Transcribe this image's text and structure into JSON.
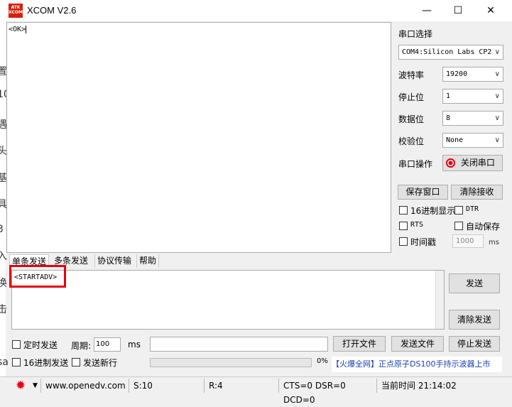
{
  "window": {
    "title": "XCOM V2.6",
    "logo_text": "ATK XCOM",
    "minimize": "—",
    "maximize": "☐",
    "close": "✕"
  },
  "left_strip_chars": [
    "置",
    "10",
    "遇",
    "头",
    "基",
    "具",
    "3",
    "入",
    "换",
    "击",
    "sa"
  ],
  "receive": {
    "text": "<OK>"
  },
  "settings": {
    "port_select_label": "串口选择",
    "port_value": "COM4:Silicon Labs CP2",
    "baud_label": "波特率",
    "baud_value": "19200",
    "stop_label": "停止位",
    "stop_value": "1",
    "data_label": "数据位",
    "data_value": "8",
    "parity_label": "校验位",
    "parity_value": "None",
    "op_label": "串口操作",
    "close_port_label": "关闭串口",
    "save_window_label": "保存窗口",
    "clear_recv_label": "清除接收",
    "hex_display_label": "16进制显示",
    "dtr_label": "DTR",
    "rts_label": "RTS",
    "auto_save_label": "自动保存",
    "timestamp_label": "时间戳",
    "timestamp_ms_value": "1000",
    "ms_label": "ms"
  },
  "tabs": [
    "单条发送",
    "多条发送",
    "协议传输",
    "帮助"
  ],
  "send": {
    "text": "<STARTADV>",
    "send_label": "发送",
    "clear_send_label": "清除发送",
    "timed_send_label": "定时发送",
    "period_label": "周期:",
    "period_value": "100",
    "ms_label": "ms",
    "open_file_label": "打开文件",
    "send_file_label": "发送文件",
    "stop_send_label": "停止发送",
    "hex_send_label": "16进制发送",
    "send_newline_label": "发送新行",
    "progress_text": "0%",
    "ad_text": "【火爆全网】正点原子DS100手持示波器上市"
  },
  "status": {
    "website": "www.openedv.com",
    "sent": "S:10",
    "received": "R:4",
    "signals": "CTS=0 DSR=0 DCD=0",
    "time": "当前时间 21:14:02"
  },
  "colors": {
    "accent_red": "#e60012",
    "ad_blue": "#1a3fb0"
  }
}
